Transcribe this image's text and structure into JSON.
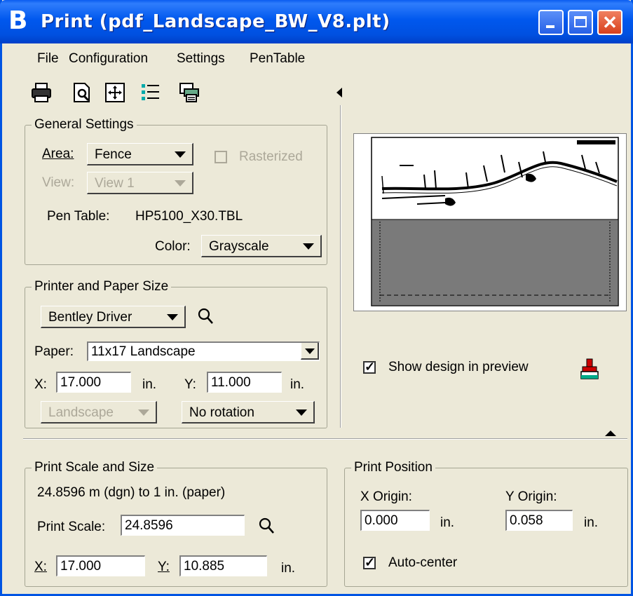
{
  "window": {
    "icon_glyph": "B",
    "title": "Print  (pdf_Landscape_BW_V8.plt)",
    "minimize_icon": "minimize-icon",
    "maximize_icon": "maximize-icon",
    "close_glyph": "✕"
  },
  "menu": {
    "file": "File",
    "configuration": "Configuration",
    "settings": "Settings",
    "pentable": "PenTable"
  },
  "toolbar": [
    "printer-icon",
    "print-preview-icon",
    "maximize-area-icon",
    "attributes-list-icon",
    "plot-config-icon"
  ],
  "general_settings": {
    "title": "General Settings",
    "area_label": "Area:",
    "area_value": "Fence",
    "rasterized_label": "Rasterized",
    "rasterized_checked": false,
    "view_label": "View:",
    "view_value": "View 1",
    "pen_table_label": "Pen Table:",
    "pen_table_value": "HP5100_X30.TBL",
    "color_label": "Color:",
    "color_value": "Grayscale"
  },
  "printer_paper": {
    "title": "Printer and Paper Size",
    "driver": "Bentley Driver",
    "paper_label": "Paper:",
    "paper_value": "11x17 Landscape",
    "x_label": "X:",
    "x_value": "17.000",
    "x_unit": "in.",
    "y_label": "Y:",
    "y_value": "11.000",
    "y_unit": "in.",
    "orientation": "Landscape",
    "rotation": "No rotation"
  },
  "preview": {
    "show_design_label": "Show design in preview",
    "show_design_checked": true
  },
  "print_scale": {
    "title": "Print Scale and Size",
    "ratio_text": "24.8596  m (dgn) to 1 in. (paper)",
    "scale_label": "Print Scale:",
    "scale_value": "24.8596",
    "x_label": "X:",
    "x_value": "17.000",
    "y_label": "Y:",
    "y_value": "10.885",
    "unit": "in."
  },
  "print_position": {
    "title": "Print Position",
    "x_origin_label": "X Origin:",
    "x_origin_value": "0.000",
    "x_unit": "in.",
    "y_origin_label": "Y Origin:",
    "y_origin_value": "0.058",
    "y_unit": "in.",
    "auto_center_label": "Auto-center",
    "auto_center_checked": true
  },
  "colors": {
    "titlebar": "#0054e3",
    "dialog_bg": "#ece9d8",
    "preview_fill": "#7a7a7a"
  }
}
